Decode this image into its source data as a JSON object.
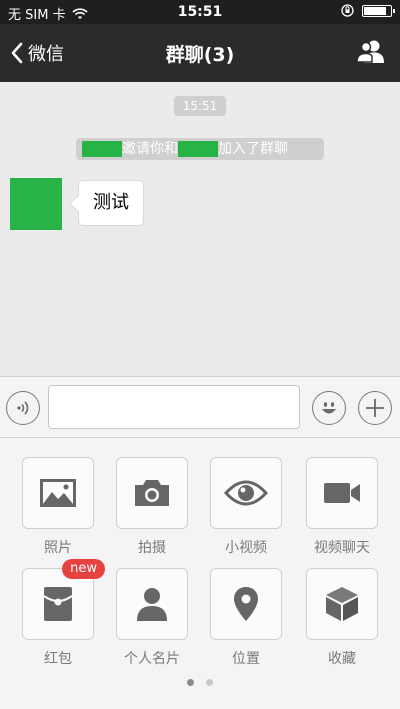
{
  "status_bar": {
    "carrier": "无 SIM 卡",
    "time": "15:51",
    "battery_level": 0.9
  },
  "nav": {
    "back_label": "微信",
    "title": "群聊(3)"
  },
  "chat": {
    "time_label": "15:51",
    "system_message": {
      "invite_text": "邀请你和",
      "joined_text": "加入了群聊"
    },
    "messages": [
      {
        "text": "测试"
      }
    ]
  },
  "input": {
    "value": ""
  },
  "panel": {
    "items": [
      {
        "label": "照片",
        "icon": "photo-icon"
      },
      {
        "label": "拍摄",
        "icon": "camera-icon"
      },
      {
        "label": "小视频",
        "icon": "eye-icon"
      },
      {
        "label": "视频聊天",
        "icon": "video-camera-icon"
      },
      {
        "label": "红包",
        "icon": "red-envelope-icon",
        "badge": "new"
      },
      {
        "label": "个人名片",
        "icon": "person-icon"
      },
      {
        "label": "位置",
        "icon": "location-pin-icon"
      },
      {
        "label": "收藏",
        "icon": "cube-icon"
      }
    ],
    "page": 1,
    "page_count": 2
  },
  "colors": {
    "nav_bg": "#2b2b2b",
    "name_highlight": "#27b345",
    "badge": "#e64340"
  }
}
